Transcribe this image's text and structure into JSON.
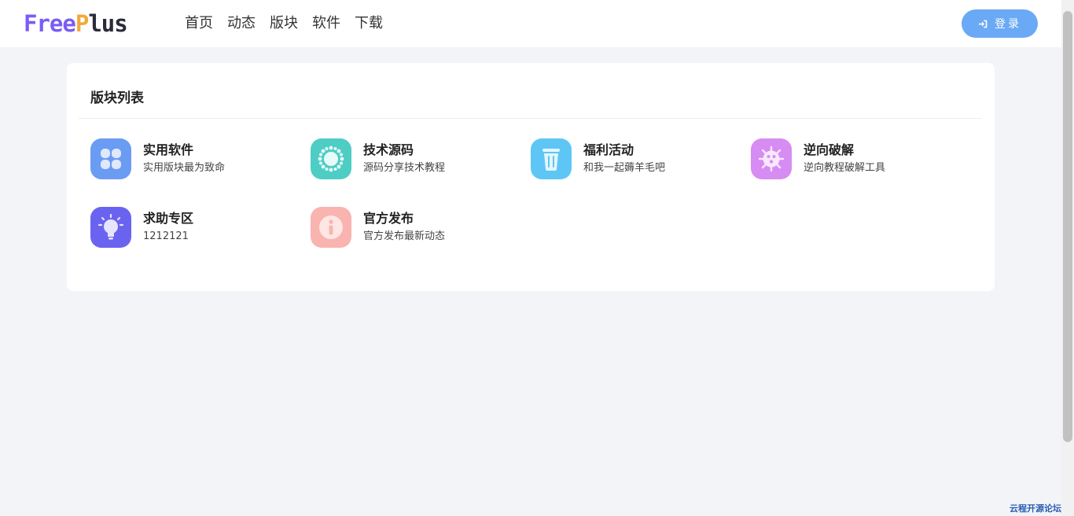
{
  "logo": {
    "part1": "Free",
    "part2": "P",
    "part3": "lus"
  },
  "nav": [
    {
      "label": "首页"
    },
    {
      "label": "动态"
    },
    {
      "label": "版块"
    },
    {
      "label": "软件"
    },
    {
      "label": "下载"
    }
  ],
  "login": {
    "label": "登录",
    "icon": "sign-in-icon"
  },
  "section": {
    "title": "版块列表"
  },
  "forums": [
    {
      "name": "实用软件",
      "desc": "实用版块最为致命",
      "icon": "four-petal-icon",
      "color": "#6b9cf3"
    },
    {
      "name": "技术源码",
      "desc": "源码分享技术教程",
      "icon": "sun-circle-icon",
      "color": "#4ecdc4"
    },
    {
      "name": "福利活动",
      "desc": "和我一起薅羊毛吧",
      "icon": "trash-can-icon",
      "color": "#5ec6f5"
    },
    {
      "name": "逆向破解",
      "desc": "逆向教程破解工具",
      "icon": "virus-icon",
      "color": "#d68cf2"
    },
    {
      "name": "求助专区",
      "desc": "1212121",
      "icon": "lightbulb-icon",
      "color": "#6a63f0"
    },
    {
      "name": "官方发布",
      "desc": "官方发布最新动态",
      "icon": "info-icon",
      "color": "#f9b4b0"
    }
  ],
  "watermark": "云程开源论坛"
}
